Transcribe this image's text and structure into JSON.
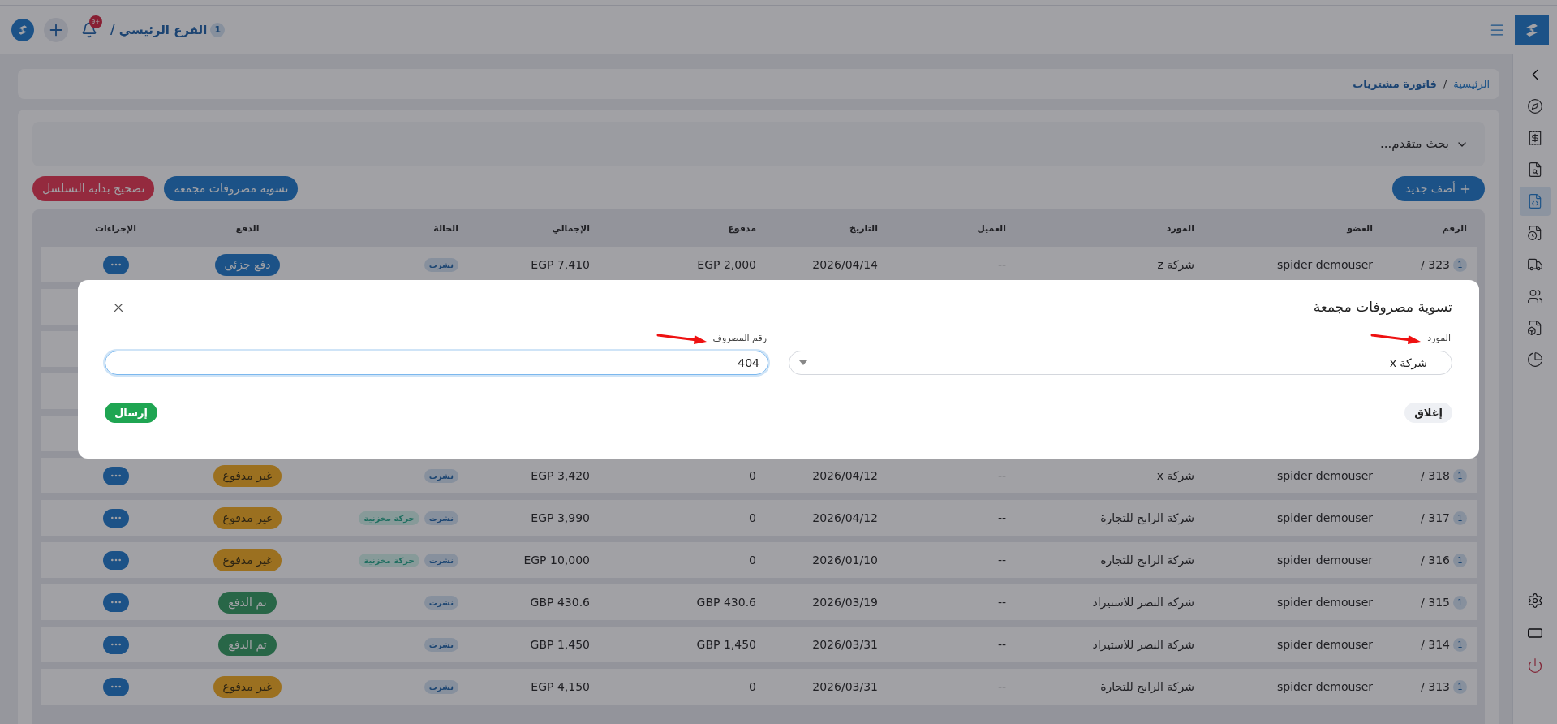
{
  "topbar": {
    "branch_count": "1",
    "branch": "الفرع الرئيسي /",
    "notifications": "+9"
  },
  "sidebar": {
    "items": [
      {
        "selected": false
      },
      {
        "selected": false
      },
      {
        "selected": false
      },
      {
        "selected": true
      },
      {
        "selected": false
      },
      {
        "selected": false
      },
      {
        "selected": false
      },
      {
        "selected": false
      },
      {
        "selected": false
      }
    ]
  },
  "breadcrumb": [
    {
      "label": "الرئيسية",
      "current": false
    },
    {
      "label": "فاتورة مشتريات",
      "current": true
    }
  ],
  "breadcrumb_separator": "/",
  "advanced_search": {
    "label": "بحث متقدم...",
    "expanded": false
  },
  "actions": [
    {
      "label": "أضف جديد",
      "kind": "add"
    },
    {
      "label": "تسوية مصروفات مجمعة",
      "kind": "primary"
    },
    {
      "label": "تصحيح بداية التسلسل",
      "kind": "danger"
    }
  ],
  "table": {
    "columns": [
      "الرقم",
      "العضو",
      "المورد",
      "العميل",
      "التاريخ",
      "مدفوع",
      "الإجمالي",
      "الحالة",
      "الدفع",
      "الإجراءات"
    ],
    "rows": [
      {
        "branch": "1",
        "number": "323 /",
        "member": "spider demouser",
        "supplier": "شركة z",
        "client": "--",
        "date": "2026/04/14",
        "paid": "EGP 2,000",
        "total": "EGP 7,410",
        "tags": [
          {
            "label": "نشرت",
            "kind": "published"
          }
        ],
        "payment": {
          "label": "دفع جزئى",
          "kind": "partial"
        }
      },
      {
        "branch": "1",
        "number": "318 /",
        "member": "spider demouser",
        "supplier": "شركة x",
        "client": "--",
        "date": "2026/04/12",
        "paid": "0",
        "total": "EGP 3,420",
        "tags": [
          {
            "label": "نشرت",
            "kind": "published"
          }
        ],
        "payment": {
          "label": "غير مدفوع",
          "kind": "unpaid"
        }
      },
      {
        "branch": "1",
        "number": "317 /",
        "member": "spider demouser",
        "supplier": "شركة الرابح للتجارة",
        "client": "--",
        "date": "2026/04/12",
        "paid": "0",
        "total": "EGP 3,990",
        "tags": [
          {
            "label": "نشرت",
            "kind": "published"
          },
          {
            "label": "حركة مخزنية",
            "kind": "stock"
          }
        ],
        "payment": {
          "label": "غير مدفوع",
          "kind": "unpaid"
        }
      },
      {
        "branch": "1",
        "number": "316 /",
        "member": "spider demouser",
        "supplier": "شركة الرابح للتجارة",
        "client": "--",
        "date": "2026/01/10",
        "paid": "0",
        "total": "EGP 10,000",
        "tags": [
          {
            "label": "نشرت",
            "kind": "published"
          },
          {
            "label": "حركة مخزنية",
            "kind": "stock"
          }
        ],
        "payment": {
          "label": "غير مدفوع",
          "kind": "unpaid"
        }
      },
      {
        "branch": "1",
        "number": "315 /",
        "member": "spider demouser",
        "supplier": "شركة النصر للاستيراد",
        "client": "--",
        "date": "2026/03/19",
        "paid": "GBP 430.6",
        "total": "GBP 430.6",
        "tags": [
          {
            "label": "نشرت",
            "kind": "published"
          }
        ],
        "payment": {
          "label": "تم الدفع",
          "kind": "paid"
        }
      },
      {
        "branch": "1",
        "number": "314 /",
        "member": "spider demouser",
        "supplier": "شركة النصر للاستيراد",
        "client": "--",
        "date": "2026/03/31",
        "paid": "GBP 1,450",
        "total": "GBP 1,450",
        "tags": [
          {
            "label": "نشرت",
            "kind": "published"
          }
        ],
        "payment": {
          "label": "تم الدفع",
          "kind": "paid"
        }
      },
      {
        "branch": "1",
        "number": "313 /",
        "member": "spider demouser",
        "supplier": "شركة الرابح للتجارة",
        "client": "--",
        "date": "2026/03/31",
        "paid": "0",
        "total": "EGP 4,150",
        "tags": [
          {
            "label": "نشرت",
            "kind": "published"
          }
        ],
        "payment": {
          "label": "غير مدفوع",
          "kind": "unpaid"
        }
      }
    ]
  },
  "modal": {
    "title": "تسوية مصروفات مجمعة",
    "fields": [
      {
        "kind": "select",
        "label": "المورد",
        "value": "شركة x",
        "focused": false
      },
      {
        "kind": "input",
        "label": "رقم المصروف",
        "value": "404",
        "focused": true
      }
    ],
    "buttons": [
      {
        "label": "إغلاق",
        "kind": "secondary"
      },
      {
        "label": "إرسال",
        "kind": "submit"
      }
    ]
  }
}
